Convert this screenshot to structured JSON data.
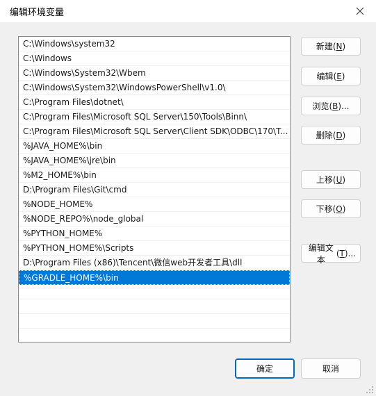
{
  "window": {
    "title": "编辑环境变量"
  },
  "list": {
    "items": [
      "C:\\Windows\\system32",
      "C:\\Windows",
      "C:\\Windows\\System32\\Wbem",
      "C:\\Windows\\System32\\WindowsPowerShell\\v1.0\\",
      "C:\\Program Files\\dotnet\\",
      "C:\\Program Files\\Microsoft SQL Server\\150\\Tools\\Binn\\",
      "C:\\Program Files\\Microsoft SQL Server\\Client SDK\\ODBC\\170\\T...",
      "%JAVA_HOME%\\bin",
      "%JAVA_HOME%\\jre\\bin",
      "%M2_HOME%\\bin",
      "D:\\Program Files\\Git\\cmd",
      "%NODE_HOME%",
      "%NODE_REPO%\\node_global",
      "%PYTHON_HOME%",
      "%PYTHON_HOME%\\Scripts",
      "D:\\Program Files (x86)\\Tencent\\微信web开发者工具\\dll",
      "%GRADLE_HOME%\\bin"
    ],
    "selected_index": 16
  },
  "buttons": {
    "new": {
      "label": "新建",
      "mnemonic": "N"
    },
    "edit": {
      "label": "编辑",
      "mnemonic": "E"
    },
    "browse": {
      "label": "浏览",
      "mnemonic": "B",
      "suffix": "..."
    },
    "delete": {
      "label": "删除",
      "mnemonic": "D"
    },
    "move_up": {
      "label": "上移",
      "mnemonic": "U"
    },
    "move_down": {
      "label": "下移",
      "mnemonic": "O"
    },
    "edit_text": {
      "label": "编辑文本",
      "mnemonic": "T",
      "suffix": "..."
    },
    "ok": {
      "label": "确定"
    },
    "cancel": {
      "label": "取消"
    }
  },
  "colors": {
    "selection": "#0078d7",
    "accent": "#0067c0"
  }
}
